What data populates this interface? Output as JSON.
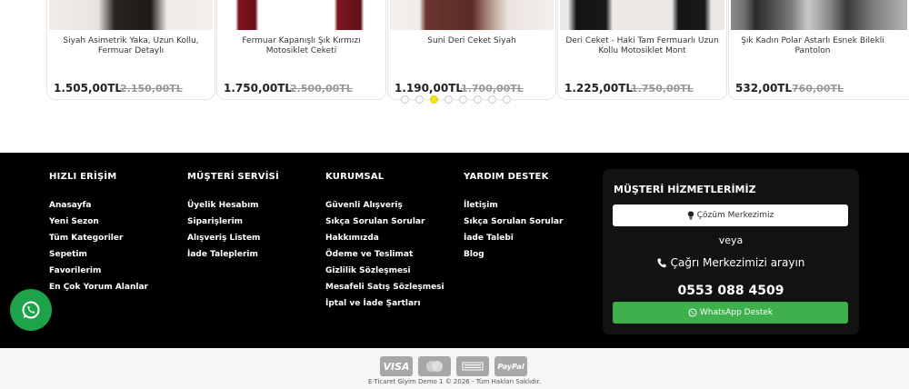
{
  "products": [
    {
      "title": "Siyah Asimetrik Yaka, Uzun Kollu, Fermuar Detaylı",
      "price": "1.505,00TL",
      "old_price": "2.150,00TL"
    },
    {
      "title": "Fermuar Kapanışlı Şık Kırmızı Motosiklet Ceketi",
      "price": "1.750,00TL",
      "old_price": "2.500,00TL"
    },
    {
      "title": "Suni Deri Ceket Siyah",
      "price": "1.190,00TL",
      "old_price": "1.700,00TL"
    },
    {
      "title": "Deri Ceket - Haki Tam Fermuarlı Uzun Kollu Motosiklet Mont",
      "price": "1.225,00TL",
      "old_price": "1.750,00TL"
    },
    {
      "title": "Şık Kadın Polar Astarlı Esnek Bilekli Pantolon",
      "price": "532,00TL",
      "old_price": "760,00TL"
    }
  ],
  "carousel": {
    "dot_count": 8,
    "active_index": 2
  },
  "footer": {
    "quick": {
      "title": "HIZLI ERİŞİM",
      "items": [
        "Anasayfa",
        "Yeni Sezon",
        "Tüm Kategoriler",
        "Sepetim",
        "Favorilerim",
        "En Çok Yorum Alanlar"
      ]
    },
    "customer": {
      "title": "MÜŞTERİ SERVİSİ",
      "items": [
        "Üyelik Hesabım",
        "Siparişlerim",
        "Alışveriş Listem",
        "İade Taleplerim"
      ]
    },
    "corporate": {
      "title": "KURUMSAL",
      "items": [
        "Güvenli Alışveriş",
        "Sıkça Sorulan Sorular",
        "Hakkımızda",
        "Ödeme ve Teslimat",
        "Gizlilik Sözleşmesi",
        "Mesafeli Satış Sözleşmesi",
        "İptal ve İade Şartları"
      ]
    },
    "help": {
      "title": "YARDIM DESTEK",
      "items": [
        "İletişim",
        "Sıkça Sorulan Sorular",
        "İade Talebi",
        "Blog"
      ]
    },
    "support": {
      "title": "MÜŞTERİ HİZMETLERİMİZ",
      "solution_label": "Çözüm Merkezimiz",
      "or_text": "veya",
      "call_text": "Çağrı Merkezimizi arayın",
      "phone": "0553 088 4509",
      "whatsapp_label": "WhatsApp Destek"
    }
  },
  "payment_cards": [
    "VISA",
    "MasterCard",
    "Amex",
    "PayPal"
  ],
  "copyright": "E-Ticaret Giyim Demo 1 © 2026 - Tüm Hakları Saklıdır.",
  "colors": {
    "accent_dot": "#f2e51b",
    "whatsapp_green": "#3eb04c",
    "footer_bg": "#000000"
  }
}
